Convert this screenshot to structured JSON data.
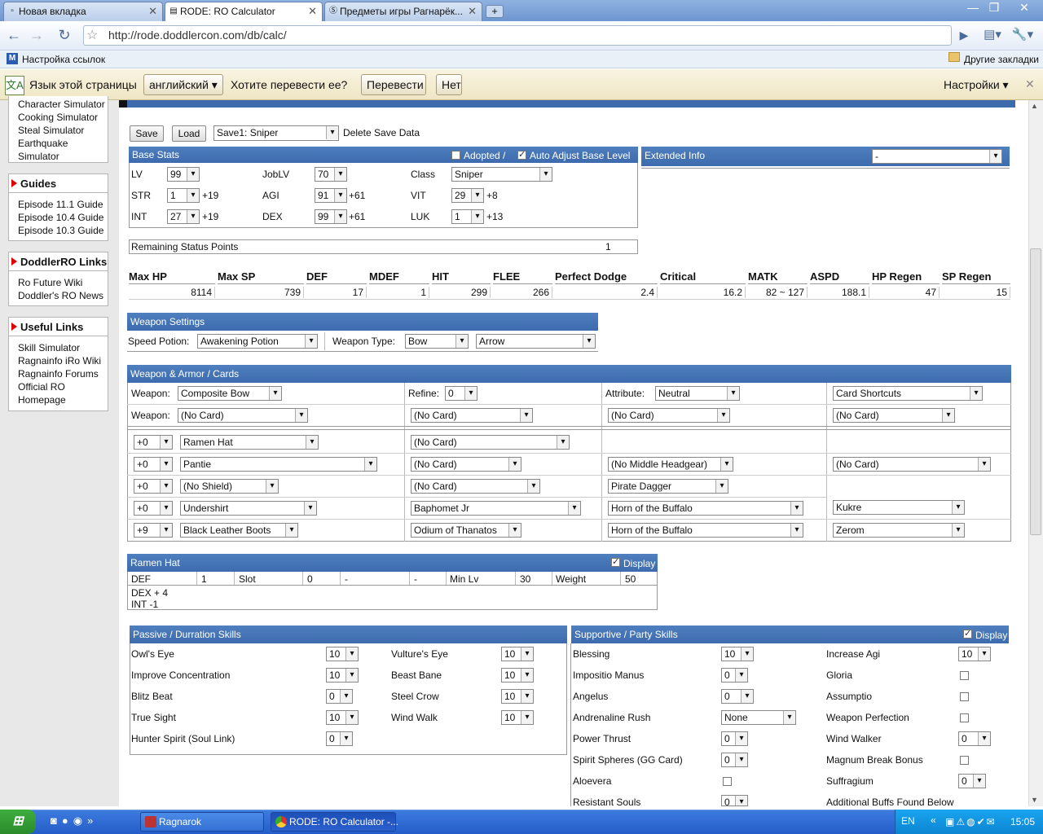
{
  "browser": {
    "tabs": [
      {
        "label": "Новая вкладка",
        "icon": "blank-page-icon"
      },
      {
        "label": "RODE: RO Calculator",
        "icon": "page-icon"
      },
      {
        "label": "Предметы игры Рагнарёк...",
        "icon": "site-icon"
      }
    ],
    "url": "http://rode.doddlercon.com/db/calc/",
    "bookmark": "Настройка ссылок",
    "other_bookmarks": "Другие закладки",
    "translate": {
      "prompt_lang": "Язык этой страницы",
      "lang": "английский",
      "question": "Хотите перевести ее?",
      "translate_btn": "Перевести",
      "no_btn": "Нет",
      "settings": "Настройки"
    }
  },
  "sidebar": {
    "top_items": [
      "Character Simulator",
      "Cooking Simulator",
      "Steal Simulator",
      "Earthquake",
      "Simulator"
    ],
    "guides": {
      "title": "Guides",
      "items": [
        "Episode 11.1 Guide",
        "Episode 10.4 Guide",
        "Episode 10.3 Guide"
      ]
    },
    "doddler": {
      "title": "DoddlerRO Links",
      "items": [
        "Ro Future Wiki",
        "Doddler's RO News"
      ]
    },
    "useful": {
      "title": "Useful Links",
      "items": [
        "Skill Simulator",
        "Ragnainfo iRo Wiki",
        "Ragnainfo Forums",
        "Official RO",
        "Homepage"
      ]
    }
  },
  "save": {
    "save": "Save",
    "load": "Load",
    "slot": "Save1: Sniper",
    "delete": "Delete Save Data"
  },
  "base": {
    "title": "Base Stats",
    "adopted": "Adopted /",
    "auto": "Auto Adjust Base Level",
    "lv_l": "LV",
    "lv": "99",
    "joblv_l": "JobLV",
    "joblv": "70",
    "class_l": "Class",
    "class": "Sniper",
    "str_l": "STR",
    "str": "1",
    "str_b": "+19",
    "agi_l": "AGI",
    "agi": "91",
    "agi_b": "+61",
    "vit_l": "VIT",
    "vit": "29",
    "vit_b": "+8",
    "int_l": "INT",
    "int": "27",
    "int_b": "+19",
    "dex_l": "DEX",
    "dex": "99",
    "dex_b": "+61",
    "luk_l": "LUK",
    "luk": "1",
    "luk_b": "+13",
    "rem_l": "Remaining Status Points",
    "rem": "1"
  },
  "ext": {
    "title": "Extended Info",
    "value": "-"
  },
  "stats": {
    "h": [
      "Max HP",
      "Max SP",
      "DEF",
      "MDEF",
      "HIT",
      "FLEE",
      "Perfect Dodge",
      "Critical",
      "MATK",
      "ASPD",
      "HP Regen",
      "SP Regen"
    ],
    "v": [
      "8114",
      "739",
      "17",
      "1",
      "299",
      "266",
      "2.4",
      "16.2",
      "82 ~ 127",
      "188.1",
      "47",
      "15"
    ]
  },
  "weapon": {
    "title": "Weapon Settings",
    "speed_l": "Speed Potion:",
    "speed": "Awakening Potion",
    "type_l": "Weapon Type:",
    "type": "Bow",
    "ammo": "Arrow"
  },
  "armor": {
    "title": "Weapon & Armor / Cards",
    "weapon_l": "Weapon:",
    "weapon": "Composite Bow",
    "refine_l": "Refine:",
    "refine": "0",
    "attr_l": "Attribute:",
    "attr": "Neutral",
    "shortcuts": "Card Shortcuts",
    "wcard_l": "Weapon:",
    "wc1": "(No Card)",
    "wc2": "(No Card)",
    "wc3": "(No Card)",
    "wc4": "(No Card)",
    "rows": [
      {
        "r": "+0",
        "item": "Ramen Hat",
        "card": "(No Card)",
        "c3": "",
        "c4": ""
      },
      {
        "r": "+0",
        "item": "Pantie",
        "card": "(No Card)",
        "c3": "(No Middle Headgear)",
        "c4": "(No Card)"
      },
      {
        "r": "+0",
        "item": "(No Shield)",
        "card": "(No Card)",
        "c3": "Pirate Dagger",
        "c4": ""
      },
      {
        "r": "+0",
        "item": "Undershirt",
        "card": "Baphomet Jr",
        "c3": "Horn of the Buffalo",
        "c4": "Kukre"
      },
      {
        "r": "+9",
        "item": "Black Leather Boots",
        "card": "Odium of Thanatos",
        "c3": "Horn of the Buffalo",
        "c4": "Zerom"
      }
    ]
  },
  "item": {
    "title": "Ramen Hat",
    "display": "Display",
    "cells": [
      "DEF",
      "1",
      "Slot",
      "0",
      "-",
      "-",
      "Min Lv",
      "30",
      "Weight",
      "50"
    ],
    "l1": "DEX + 4",
    "l2": "INT -1"
  },
  "passive": {
    "title": "Passive / Durration Skills",
    "left": [
      {
        "n": "Owl's Eye",
        "v": "10"
      },
      {
        "n": "Improve Concentration",
        "v": "10"
      },
      {
        "n": "Blitz Beat",
        "v": "0"
      },
      {
        "n": "True Sight",
        "v": "10"
      },
      {
        "n": "Hunter Spirit (Soul Link)",
        "v": "0"
      }
    ],
    "right": [
      {
        "n": "Vulture's Eye",
        "v": "10"
      },
      {
        "n": "Beast Bane",
        "v": "10"
      },
      {
        "n": "Steel Crow",
        "v": "10"
      },
      {
        "n": "Wind Walk",
        "v": "10"
      }
    ]
  },
  "support": {
    "title": "Supportive / Party Skills",
    "display": "Display",
    "left": [
      {
        "n": "Blessing",
        "v": "10"
      },
      {
        "n": "Impositio Manus",
        "v": "0"
      },
      {
        "n": "Angelus",
        "v": "0"
      },
      {
        "n": "Andrenaline Rush",
        "v": "None"
      },
      {
        "n": "Power Thrust",
        "v": "0"
      },
      {
        "n": "Spirit Spheres (GG Card)",
        "v": "0"
      },
      {
        "n": "Aloevera",
        "v": ""
      },
      {
        "n": "Resistant Souls",
        "v": "0"
      }
    ],
    "right": [
      {
        "n": "Increase Agi",
        "v": "10"
      },
      {
        "n": "Gloria",
        "v": ""
      },
      {
        "n": "Assumptio",
        "v": ""
      },
      {
        "n": "Weapon Perfection",
        "v": ""
      },
      {
        "n": "Wind Walker",
        "v": "0"
      },
      {
        "n": "Magnum Break Bonus",
        "v": ""
      },
      {
        "n": "Suffragium",
        "v": "0"
      },
      {
        "n": "Additional Buffs Found Below",
        "v": ""
      }
    ]
  },
  "taskbar": {
    "t1": "Ragnarok",
    "t2": "RODE: RO Calculator -...",
    "lang": "EN",
    "time": "15:05"
  }
}
